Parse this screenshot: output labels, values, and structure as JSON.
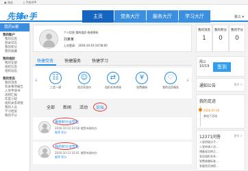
{
  "topbar": {
    "left": "▣ 淘金",
    "app": "▯ 手机APP"
  },
  "header": {
    "logo": "先锋e手",
    "nav": [
      "主页",
      "党务大厅",
      "服务大厅",
      "学习大厅"
    ],
    "user": "张三 ▾"
  },
  "sidebar": {
    "title": "我的e家",
    "groups": [
      {
        "head": "我的账户",
        "items": [
          "我的信息",
          "登录日志",
          "我的积分",
          "我的收藏"
        ]
      },
      {
        "head": "我的组织",
        "items": [
          "我的支部",
          "组织信息",
          "组织动态"
        ]
      },
      {
        "head": "我的党员",
        "items": [
          "我的消息",
          "有关事项报告",
          "入党申请书",
          "思想汇报",
          "年度小结",
          "组织关系转接",
          "我的人员",
          "学习档案",
          "我的学分"
        ]
      }
    ]
  },
  "profile": {
    "tags": "个人信息  我的组织  修改密码",
    "name": "刘某某",
    "last_login": "上次登录：  2016-10-19 10:58:00"
  },
  "tabs1": [
    "快捷党务",
    "快捷服务",
    "快捷学习"
  ],
  "quick": [
    "三会一课",
    "党员亮身份",
    "组织关系转接",
    "党费缴纳",
    "我的志愿服务"
  ],
  "tabs2": [
    "全部",
    "新闻",
    "活动",
    "论坛"
  ],
  "posts": [
    {
      "title": "推荐积分运营帖",
      "meta": "2016-10-13 10:58   诸暨市政府办",
      "tag": "推荐  积分"
    },
    {
      "title": "我的积分运营帖",
      "meta": "2016-10-13 16:41   诸暨市政府办",
      "tag": "推荐  积分"
    }
  ],
  "stats": [
    {
      "label": "我的消息",
      "value": "1"
    },
    {
      "label": "我的积分",
      "value": "0"
    },
    {
      "label": "我的学分",
      "value": "0"
    }
  ],
  "sign": {
    "date": "周三\n10/19",
    "button": "签到"
  },
  "notice": {
    "title": "通知公告",
    "more": "更多 >"
  },
  "activity": {
    "title": "我的足迹",
    "date": "2016-07-20",
    "text": "参加了活动"
  },
  "hot": {
    "title": "12371问答",
    "more": "更多 >",
    "rows": [
      "入党积极分子...",
      "入党申请人员...",
      "预备党员转正...",
      "党员组织关系...",
      "党费收缴标准...",
      "发展党员流程..."
    ]
  }
}
